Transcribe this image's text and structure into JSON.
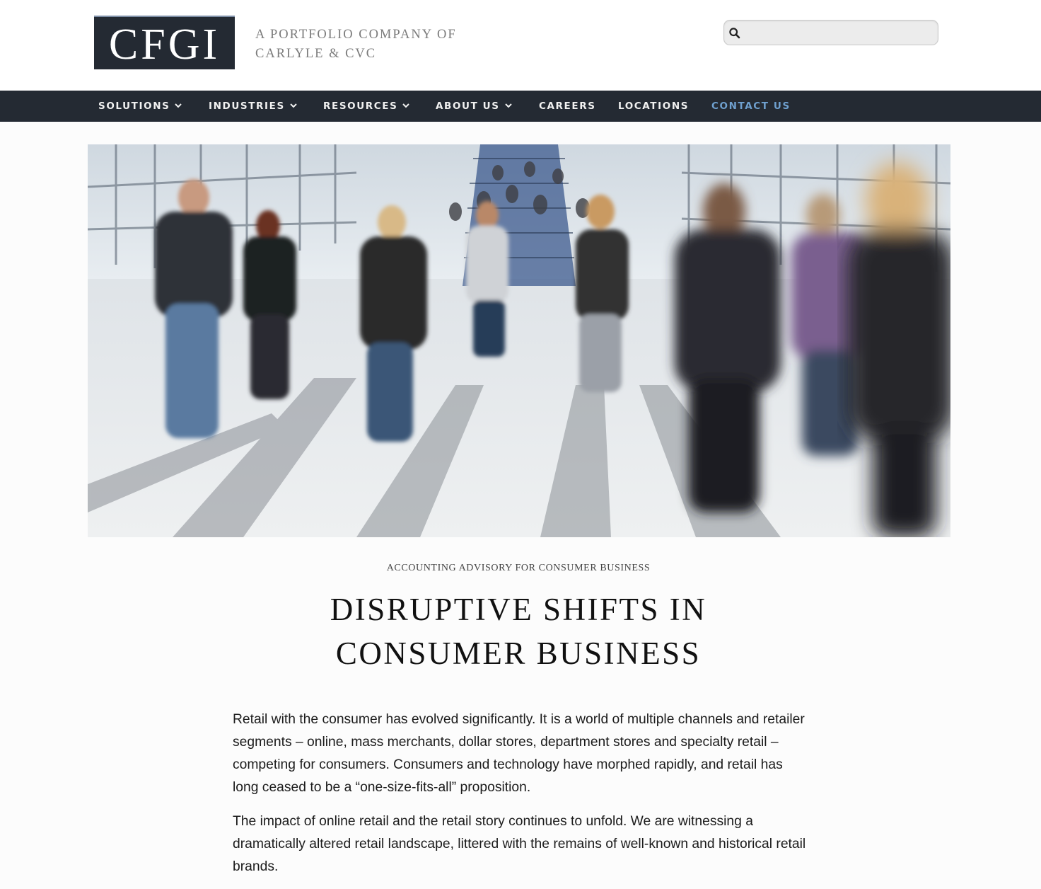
{
  "header": {
    "logo_text": "CFGI",
    "tagline_line1": "A PORTFOLIO COMPANY OF",
    "tagline_line2": "CARLYLE & CVC",
    "search": {
      "placeholder": "",
      "value": ""
    }
  },
  "nav": {
    "items": [
      {
        "label": "SOLUTIONS",
        "has_dropdown": true
      },
      {
        "label": "INDUSTRIES",
        "has_dropdown": true
      },
      {
        "label": "RESOURCES",
        "has_dropdown": true
      },
      {
        "label": "ABOUT US",
        "has_dropdown": true
      },
      {
        "label": "CAREERS",
        "has_dropdown": false
      },
      {
        "label": "LOCATIONS",
        "has_dropdown": false
      },
      {
        "label": "CONTACT US",
        "has_dropdown": false,
        "active": true
      }
    ]
  },
  "hero": {
    "image": "crowd-walking-through-terminal-photo"
  },
  "article": {
    "eyebrow": "ACCOUNTING ADVISORY FOR CONSUMER BUSINESS",
    "title_line1": "DISRUPTIVE SHIFTS IN",
    "title_line2": "CONSUMER BUSINESS",
    "paragraphs": [
      "Retail with the consumer has evolved significantly. It is a world of multiple channels and retailer segments – online, mass merchants, dollar stores, department stores and specialty retail – competing for consumers. Consumers and technology have morphed rapidly, and retail has long ceased to be a “one-size-fits-all” proposition.",
      "The impact of online retail and the retail story continues to unfold. We are witnessing a dramatically altered retail landscape, littered with the remains of well-known and historical retail brands."
    ]
  },
  "colors": {
    "nav_background": "#242a33",
    "nav_active": "#6fa0cf",
    "logo_background": "#242a33"
  }
}
